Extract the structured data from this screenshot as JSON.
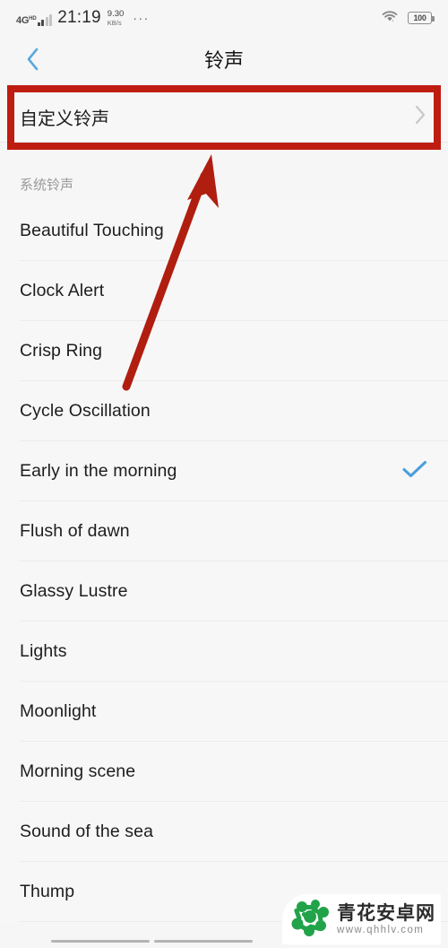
{
  "status_bar": {
    "network_type": "4G",
    "network_suffix": "HD",
    "time": "21:19",
    "speed_value": "9.30",
    "speed_unit": "KB/s",
    "overflow": "···",
    "wifi_icon": "wifi-icon",
    "battery_level": "100"
  },
  "header": {
    "title": "铃声",
    "back_icon": "chevron-left-icon",
    "back_color": "#5ba9dd"
  },
  "custom_ringtone": {
    "label": "自定义铃声",
    "chevron_icon": "chevron-right-icon",
    "chevron_color": "#c8c8c8"
  },
  "section": {
    "title": "系统铃声"
  },
  "ringtones": [
    {
      "name": "Beautiful Touching",
      "selected": false
    },
    {
      "name": "Clock Alert",
      "selected": false
    },
    {
      "name": "Crisp Ring",
      "selected": false
    },
    {
      "name": "Cycle Oscillation",
      "selected": false
    },
    {
      "name": "Early in the morning",
      "selected": true
    },
    {
      "name": "Flush of dawn",
      "selected": false
    },
    {
      "name": "Glassy Lustre",
      "selected": false
    },
    {
      "name": "Lights",
      "selected": false
    },
    {
      "name": "Moonlight",
      "selected": false
    },
    {
      "name": "Morning scene",
      "selected": false
    },
    {
      "name": "Sound of the sea",
      "selected": false
    },
    {
      "name": "Thump",
      "selected": false
    }
  ],
  "selection": {
    "check_icon": "check-icon",
    "check_color": "#4a9fdb"
  },
  "annotations": {
    "highlight_color": "#bf1d11",
    "arrow_color": "#b01e10",
    "rect_target": "custom-ringtone-row",
    "arrow_points_to": "custom-ringtone-row"
  },
  "watermark": {
    "site_name": "青花安卓网",
    "url": "www.qhhlv.com",
    "logo_color": "#22a34a"
  },
  "colors": {
    "background": "#f6f6f6",
    "row_background": "#f7f7f7",
    "separator": "#ececec",
    "primary_text": "#1d1d1d",
    "secondary_text": "#9a9a9a"
  }
}
